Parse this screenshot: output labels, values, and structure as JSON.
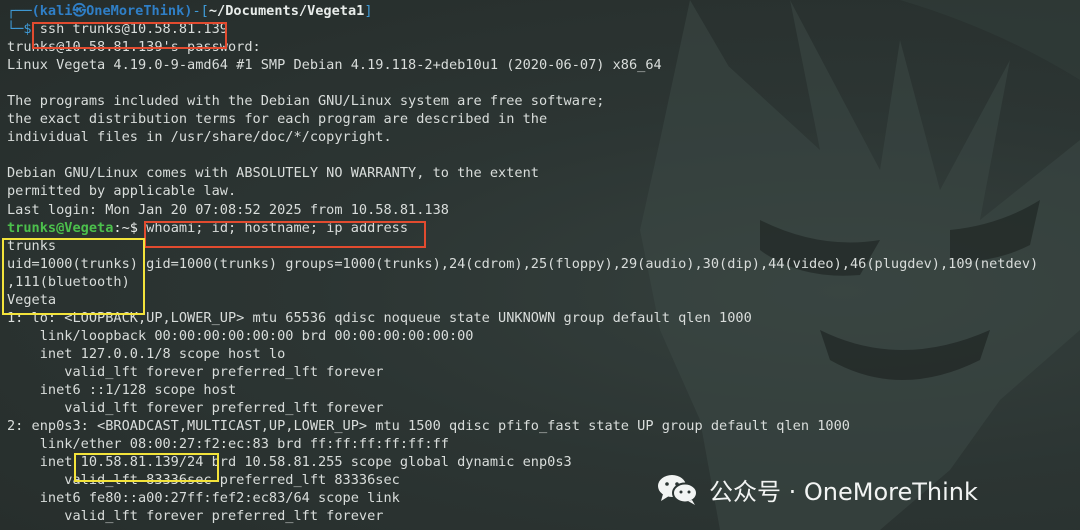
{
  "terminal": {
    "lines": [
      {
        "type": "prompt_top",
        "user": "(kali㉿OneMoreThink)",
        "dir": "~/Documents/Vegeta1"
      },
      {
        "type": "prompt_cmd",
        "cmd": "ssh trunks@10.58.81.139"
      },
      {
        "type": "text",
        "text": "trunks@10.58.81.139's password:"
      },
      {
        "type": "text",
        "text": "Linux Vegeta 4.19.0-9-amd64 #1 SMP Debian 4.19.118-2+deb10u1 (2020-06-07) x86_64"
      },
      {
        "type": "text",
        "text": ""
      },
      {
        "type": "text",
        "text": "The programs included with the Debian GNU/Linux system are free software;"
      },
      {
        "type": "text",
        "text": "the exact distribution terms for each program are described in the"
      },
      {
        "type": "text",
        "text": "individual files in /usr/share/doc/*/copyright."
      },
      {
        "type": "text",
        "text": ""
      },
      {
        "type": "text",
        "text": "Debian GNU/Linux comes with ABSOLUTELY NO WARRANTY, to the extent"
      },
      {
        "type": "text",
        "text": "permitted by applicable law."
      },
      {
        "type": "text",
        "text": "Last login: Mon Jan 20 07:08:52 2025 from 10.58.81.138"
      },
      {
        "type": "prompt_remote",
        "user": "trunks@Vegeta",
        "dir": ":~$ ",
        "cmd": "whoami; id; hostname; ip address"
      },
      {
        "type": "text",
        "text": "trunks"
      },
      {
        "type": "text",
        "text": "uid=1000(trunks) gid=1000(trunks) groups=1000(trunks),24(cdrom),25(floppy),29(audio),30(dip),44(video),46(plugdev),109(netdev)"
      },
      {
        "type": "text",
        "text": ",111(bluetooth)"
      },
      {
        "type": "text",
        "text": "Vegeta"
      },
      {
        "type": "text",
        "text": "1: lo: <LOOPBACK,UP,LOWER_UP> mtu 65536 qdisc noqueue state UNKNOWN group default qlen 1000"
      },
      {
        "type": "text",
        "text": "    link/loopback 00:00:00:00:00:00 brd 00:00:00:00:00:00"
      },
      {
        "type": "text",
        "text": "    inet 127.0.0.1/8 scope host lo"
      },
      {
        "type": "text",
        "text": "       valid_lft forever preferred_lft forever"
      },
      {
        "type": "text",
        "text": "    inet6 ::1/128 scope host"
      },
      {
        "type": "text",
        "text": "       valid_lft forever preferred_lft forever"
      },
      {
        "type": "text",
        "text": "2: enp0s3: <BROADCAST,MULTICAST,UP,LOWER_UP> mtu 1500 qdisc pfifo_fast state UP group default qlen 1000"
      },
      {
        "type": "text",
        "text": "    link/ether 08:00:27:f2:ec:83 brd ff:ff:ff:ff:ff:ff"
      },
      {
        "type": "text",
        "text": "    inet 10.58.81.139/24 brd 10.58.81.255 scope global dynamic enp0s3"
      },
      {
        "type": "text",
        "text": "       valid_lft 83336sec preferred_lft 83336sec"
      },
      {
        "type": "text",
        "text": "    inet6 fe80::a00:27ff:fef2:ec83/64 scope link"
      },
      {
        "type": "text",
        "text": "       valid_lft forever preferred_lft forever"
      }
    ]
  },
  "watermark": {
    "text": "公众号 · OneMoreThink",
    "icon": "wechat-icon"
  },
  "colors": {
    "highlight_red": "#e24b2f",
    "highlight_yellow": "#f3e33b",
    "prompt_blue": "#3f9ad6",
    "remote_user_green": "#4cc04c"
  }
}
